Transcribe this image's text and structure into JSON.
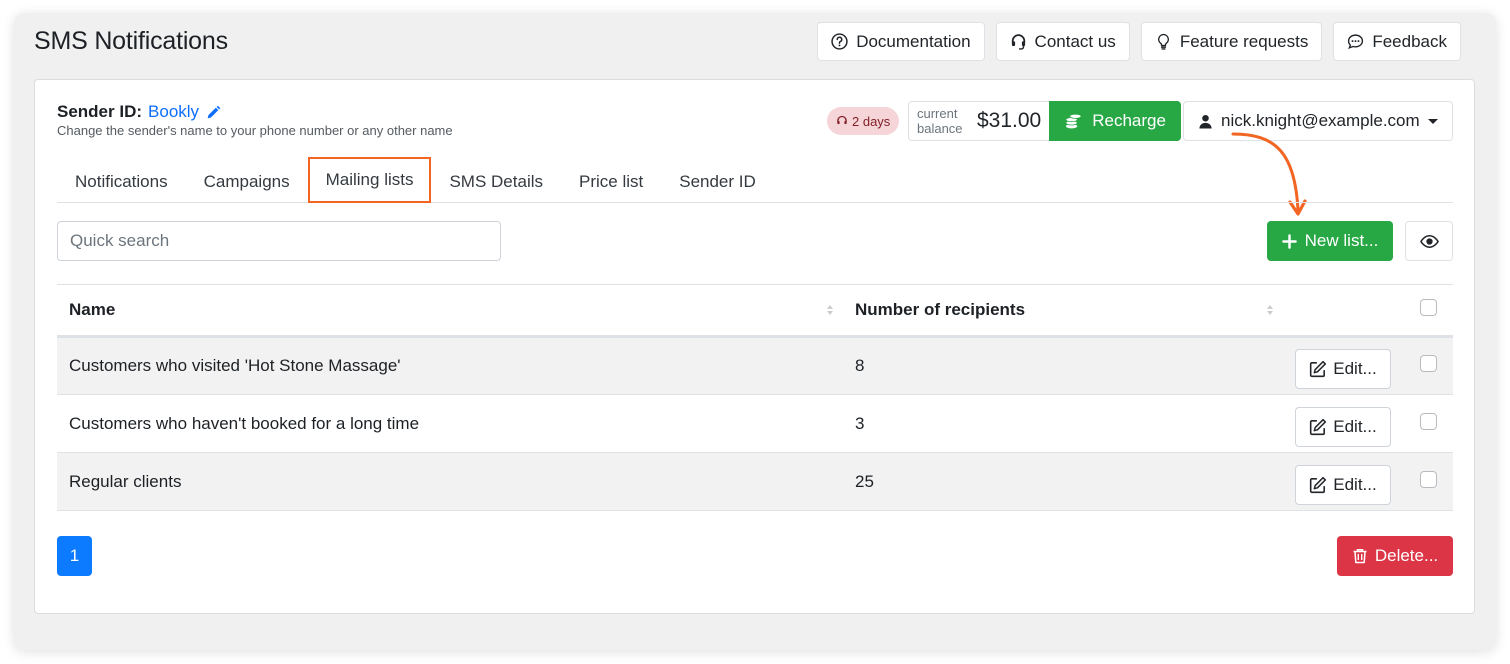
{
  "header": {
    "title": "SMS Notifications",
    "buttons": [
      {
        "label": "Documentation",
        "icon": "question-circle-icon"
      },
      {
        "label": "Contact us",
        "icon": "headset-icon"
      },
      {
        "label": "Feature requests",
        "icon": "lightbulb-icon"
      },
      {
        "label": "Feedback",
        "icon": "chat-bubble-icon"
      }
    ]
  },
  "sender": {
    "label": "Sender ID:",
    "name": "Bookly",
    "hint": "Change the sender's name to your phone number or any other name"
  },
  "account": {
    "trial_badge": "2 days",
    "balance_label": "current balance",
    "balance_amount": "$31.00",
    "recharge_label": "Recharge",
    "user_email": "nick.knight@example.com"
  },
  "tabs": [
    {
      "label": "Notifications",
      "active": false
    },
    {
      "label": "Campaigns",
      "active": false
    },
    {
      "label": "Mailing lists",
      "active": true
    },
    {
      "label": "SMS Details",
      "active": false
    },
    {
      "label": "Price list",
      "active": false
    },
    {
      "label": "Sender ID",
      "active": false
    }
  ],
  "toolbar": {
    "search_placeholder": "Quick search",
    "search_value": "",
    "new_list_label": "New list..."
  },
  "table": {
    "columns": [
      "Name",
      "Number of recipients"
    ],
    "rows": [
      {
        "name": "Customers who visited 'Hot Stone Massage'",
        "recipients": "8",
        "edit_label": "Edit..."
      },
      {
        "name": "Customers who haven't booked for a long time",
        "recipients": "3",
        "edit_label": "Edit..."
      },
      {
        "name": "Regular clients",
        "recipients": "25",
        "edit_label": "Edit..."
      }
    ]
  },
  "pagination": {
    "current_page": "1"
  },
  "footer": {
    "delete_label": "Delete..."
  },
  "colors": {
    "primary": "#0d7bff",
    "success": "#28a745",
    "danger": "#dc3545",
    "highlight": "#f26522"
  }
}
